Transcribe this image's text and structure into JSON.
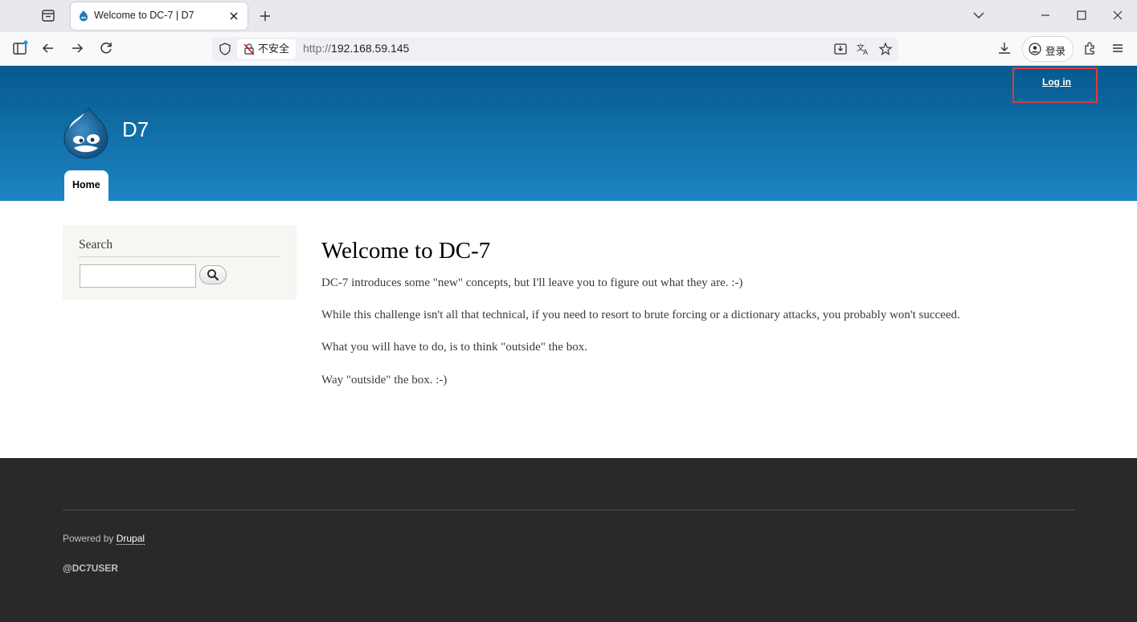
{
  "browser": {
    "tab_title": "Welcome to DC-7 | D7",
    "security_label": "不安全",
    "url_protocol": "http://",
    "url_host": "192.168.59.145",
    "account_label": "登录"
  },
  "header": {
    "site_name": "D7",
    "login_link": "Log in",
    "nav": {
      "home_label": "Home"
    }
  },
  "sidebar": {
    "search_title": "Search",
    "search_value": ""
  },
  "main": {
    "title": "Welcome to DC-7",
    "paragraphs": [
      "DC-7 introduces some \"new\" concepts, but I'll leave you to figure out what they are.  :-)",
      "While this challenge isn't all that technical, if you need to resort to brute forcing or a dictionary attacks, you probably won't succeed.",
      "What you will have to do, is to think \"outside\" the box.",
      "Way \"outside\" the box.  :-)"
    ]
  },
  "footer": {
    "powered_prefix": "Powered by",
    "powered_link": "Drupal",
    "user_tag": "@DC7USER"
  },
  "colors": {
    "header_top": "#055a8e",
    "header_bottom": "#1d84c3",
    "footer_bg": "#292929",
    "annotation": "#e03a3a"
  }
}
